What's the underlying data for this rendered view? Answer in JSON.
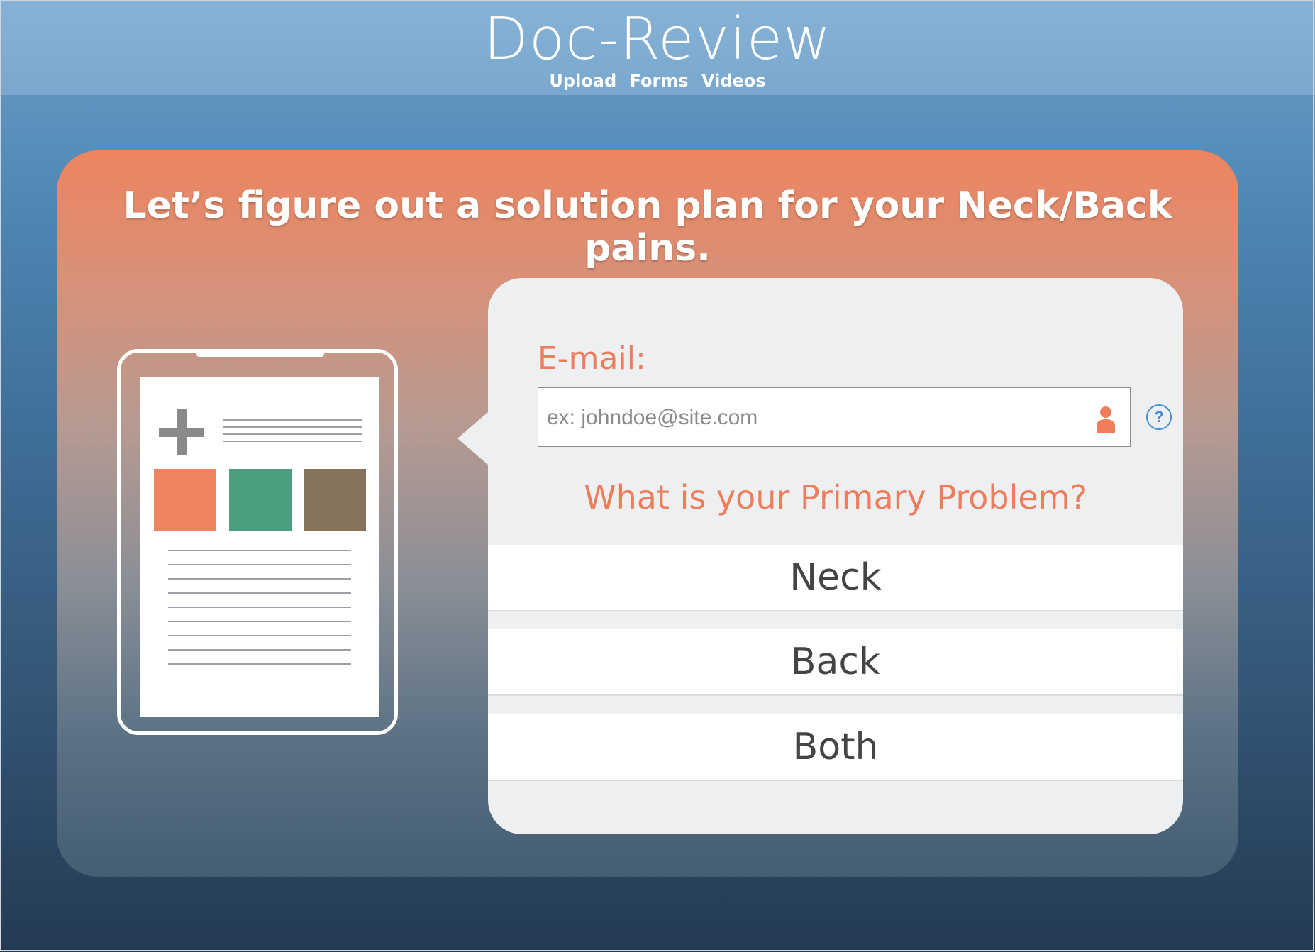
{
  "header": {
    "title": "Doc-Review",
    "nav": [
      "Upload",
      "Forms",
      "Videos"
    ]
  },
  "panel": {
    "headline": "Let’s figure out a solution plan for your Neck/Back pains."
  },
  "illustration": {
    "icon": "tablet-document-icon",
    "block_colors": [
      "#ee835d",
      "#4aa07e",
      "#85745b"
    ]
  },
  "form": {
    "email_label": "E-mail:",
    "email_placeholder": "ex: johndoe@site.com",
    "email_value": "",
    "help_glyph": "?",
    "question": "What is your Primary Problem?",
    "options": [
      "Neck",
      "Back",
      "Both"
    ]
  },
  "colors": {
    "accent": "#ee7d5c",
    "help": "#4a90d9",
    "header": "#7aa8cd"
  }
}
